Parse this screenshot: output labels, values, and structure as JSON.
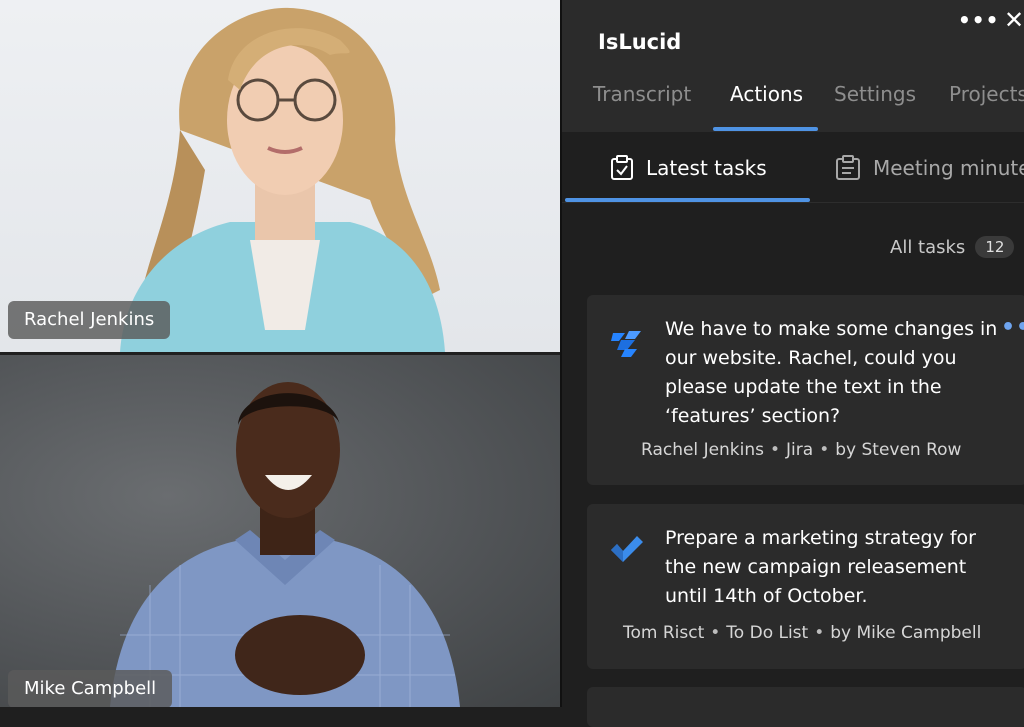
{
  "participants": [
    {
      "name": "Rachel Jenkins"
    },
    {
      "name": "Mike Campbell"
    }
  ],
  "panel": {
    "app_title": "IsLucid",
    "more_icon": "more-horizontal-icon",
    "close_icon": "close-icon",
    "tabs": [
      {
        "label": "Transcript",
        "active": false
      },
      {
        "label": "Actions",
        "active": true
      },
      {
        "label": "Settings",
        "active": false
      },
      {
        "label": "Projects",
        "active": false
      }
    ],
    "subtabs": [
      {
        "label": "Latest tasks",
        "icon": "clipboard-check-icon",
        "active": true
      },
      {
        "label": "Meeting minutes",
        "icon": "meeting-notes-icon",
        "active": false
      }
    ],
    "filter": {
      "label": "All tasks",
      "count": "12"
    },
    "tasks": [
      {
        "text": "We have to make some changes in our website. Rachel, could you please update the text in the ‘features’ section?",
        "assignee": "Rachel Jenkins",
        "source": "Jira",
        "author": "by Steven Row",
        "icon": "jira-icon"
      },
      {
        "text": "Prepare a marketing strategy for the new campaign releasement until 14th of October.",
        "assignee": "Tom Risct",
        "source": "To Do List",
        "author": "by Mike Campbell",
        "icon": "todo-check-icon"
      }
    ]
  },
  "colors": {
    "accent": "#4f93e4",
    "panel_bg": "#1f1f1f",
    "card_bg": "#2b2b2b",
    "header_bg": "#2b2b2b"
  }
}
